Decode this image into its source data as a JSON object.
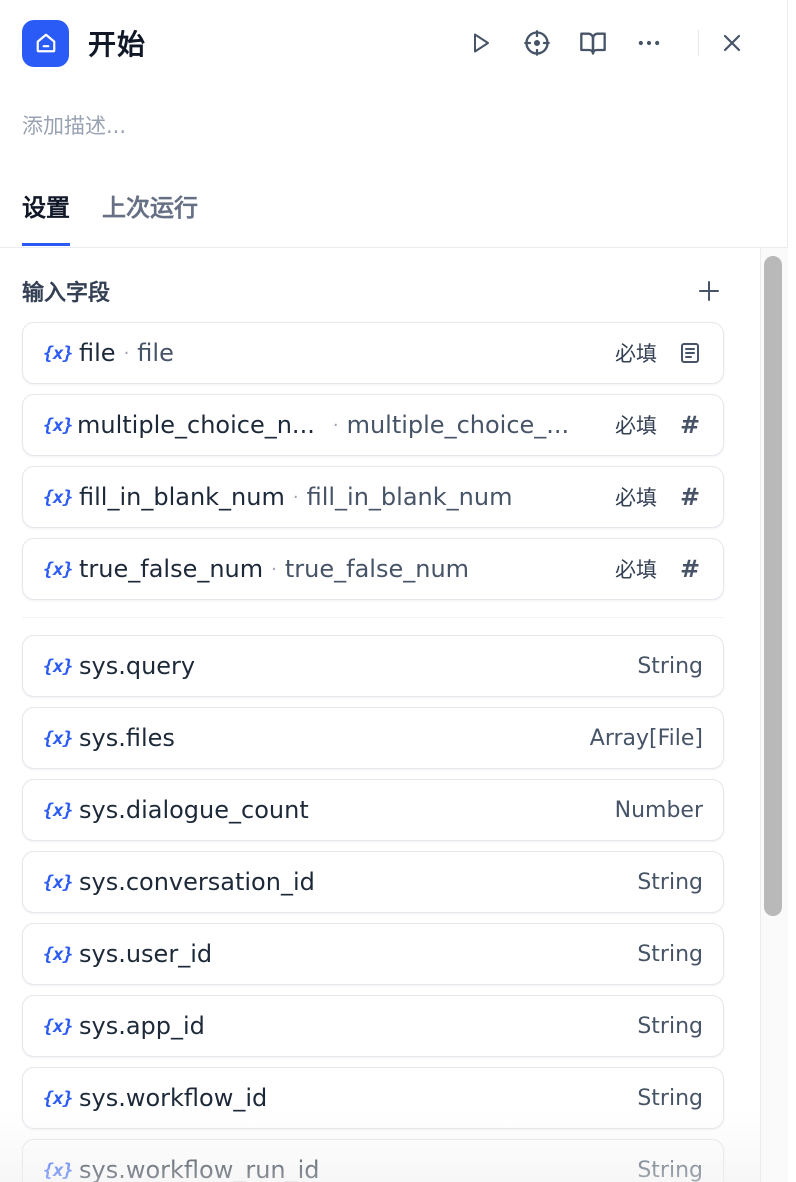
{
  "header": {
    "title": "开始",
    "description_placeholder": "添加描述..."
  },
  "tabs": [
    {
      "label": "设置"
    },
    {
      "label": "上次运行"
    }
  ],
  "section": {
    "title": "输入字段"
  },
  "input_fields": [
    {
      "name": "file",
      "label": "file",
      "required": "必填",
      "type_icon": "document-icon"
    },
    {
      "name": "multiple_choice_n...",
      "label": "multiple_choice_...",
      "required": "必填",
      "type_icon": "hash-icon"
    },
    {
      "name": "fill_in_blank_num",
      "label": "fill_in_blank_num",
      "required": "必填",
      "type_icon": "hash-icon"
    },
    {
      "name": "true_false_num",
      "label": "true_false_num",
      "required": "必填",
      "type_icon": "hash-icon"
    }
  ],
  "system_vars": [
    {
      "name": "sys.query",
      "type": "String"
    },
    {
      "name": "sys.files",
      "type": "Array[File]"
    },
    {
      "name": "sys.dialogue_count",
      "type": "Number"
    },
    {
      "name": "sys.conversation_id",
      "type": "String"
    },
    {
      "name": "sys.user_id",
      "type": "String"
    },
    {
      "name": "sys.app_id",
      "type": "String"
    },
    {
      "name": "sys.workflow_id",
      "type": "String"
    },
    {
      "name": "sys.workflow_run_id",
      "type": "String"
    }
  ],
  "icons": {
    "variable": "{x}",
    "hash": "#"
  },
  "colors": {
    "accent": "#2a5bf6"
  }
}
